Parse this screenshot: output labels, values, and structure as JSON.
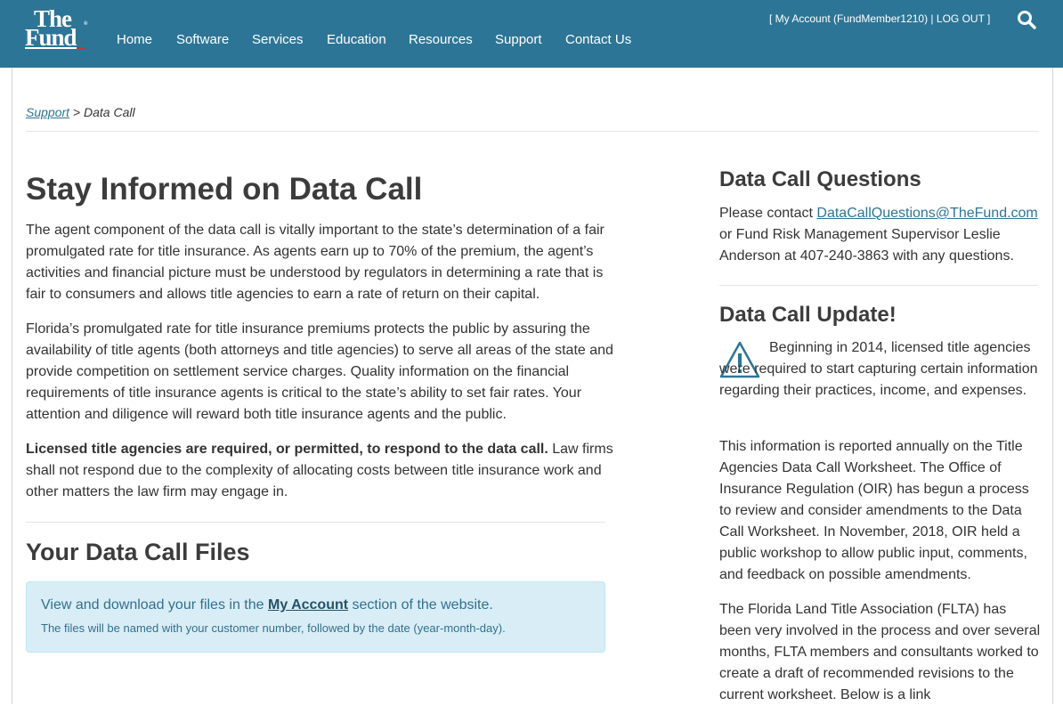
{
  "header": {
    "logo": {
      "line1": "The",
      "line2": "Fund",
      "reg": "®"
    },
    "nav": [
      "Home",
      "Software",
      "Services",
      "Education",
      "Resources",
      "Support",
      "Contact Us"
    ],
    "account": {
      "open": "[ ",
      "my_account": "My Account (FundMember1210)",
      "sep": " | ",
      "logout": "LOG OUT",
      "close": " ]"
    }
  },
  "breadcrumb": {
    "parent": "Support",
    "sep": " > ",
    "current": "Data Call"
  },
  "main": {
    "title": "Stay Informed on Data Call",
    "p1": "The agent component of the data call is vitally important to the state’s determination of a fair promulgated rate for title insurance. As agents earn up to 70% of the premium, the agent’s activities and financial picture must be understood by regulators in determining a rate that is fair to consumers and allows title agencies to earn a rate of return on their capital.",
    "p2": "Florida’s promulgated rate for title insurance premiums protects the public by assuring the availability of title agents (both attorneys and title agencies) to serve all areas of the state and provide competition on settlement service charges.  Quality information on the financial requirements of title insurance agents is critical to the state’s ability to set fair rates.  Your attention and diligence will reward both title insurance agents and the public.",
    "p3_bold": "Licensed title agencies are required, or permitted, to respond to the data call.",
    "p3_rest": " Law firms shall not respond due to the complexity of allocating costs between title insurance work and other matters the law firm may engage in.",
    "files_title": "Your Data Call Files",
    "files_box": {
      "pre": "View and download your files in the ",
      "link": "My Account",
      "post": " section of the website.",
      "note": "The files will be named with your customer number, followed by the date (year-month-day)."
    }
  },
  "sidebar": {
    "questions_title": "Data Call Questions",
    "questions_pre": "Please contact ",
    "questions_email": "DataCallQuestions@TheFund.com",
    "questions_post": " or Fund Risk Management Supervisor Leslie Anderson at 407-240-3863 with any questions.",
    "update_title": "Data Call Update!",
    "update_p1": "Beginning in 2014, licensed title agencies were required to start capturing certain information regarding their practices, income, and expenses.",
    "update_p2": "This information is reported annually on the Title Agencies Data Call Worksheet. The Office of Insurance Regulation (OIR) has begun a process to review and consider amendments to the Data Call Worksheet. In November, 2018, OIR held a public workshop to allow public input, comments, and feedback on possible amendments.",
    "update_p3": "The Florida Land Title Association (FLTA) has been very involved in the process and over several months, FLTA members and consultants worked to create a draft of recommended revisions to the current worksheet. Below is a link"
  }
}
